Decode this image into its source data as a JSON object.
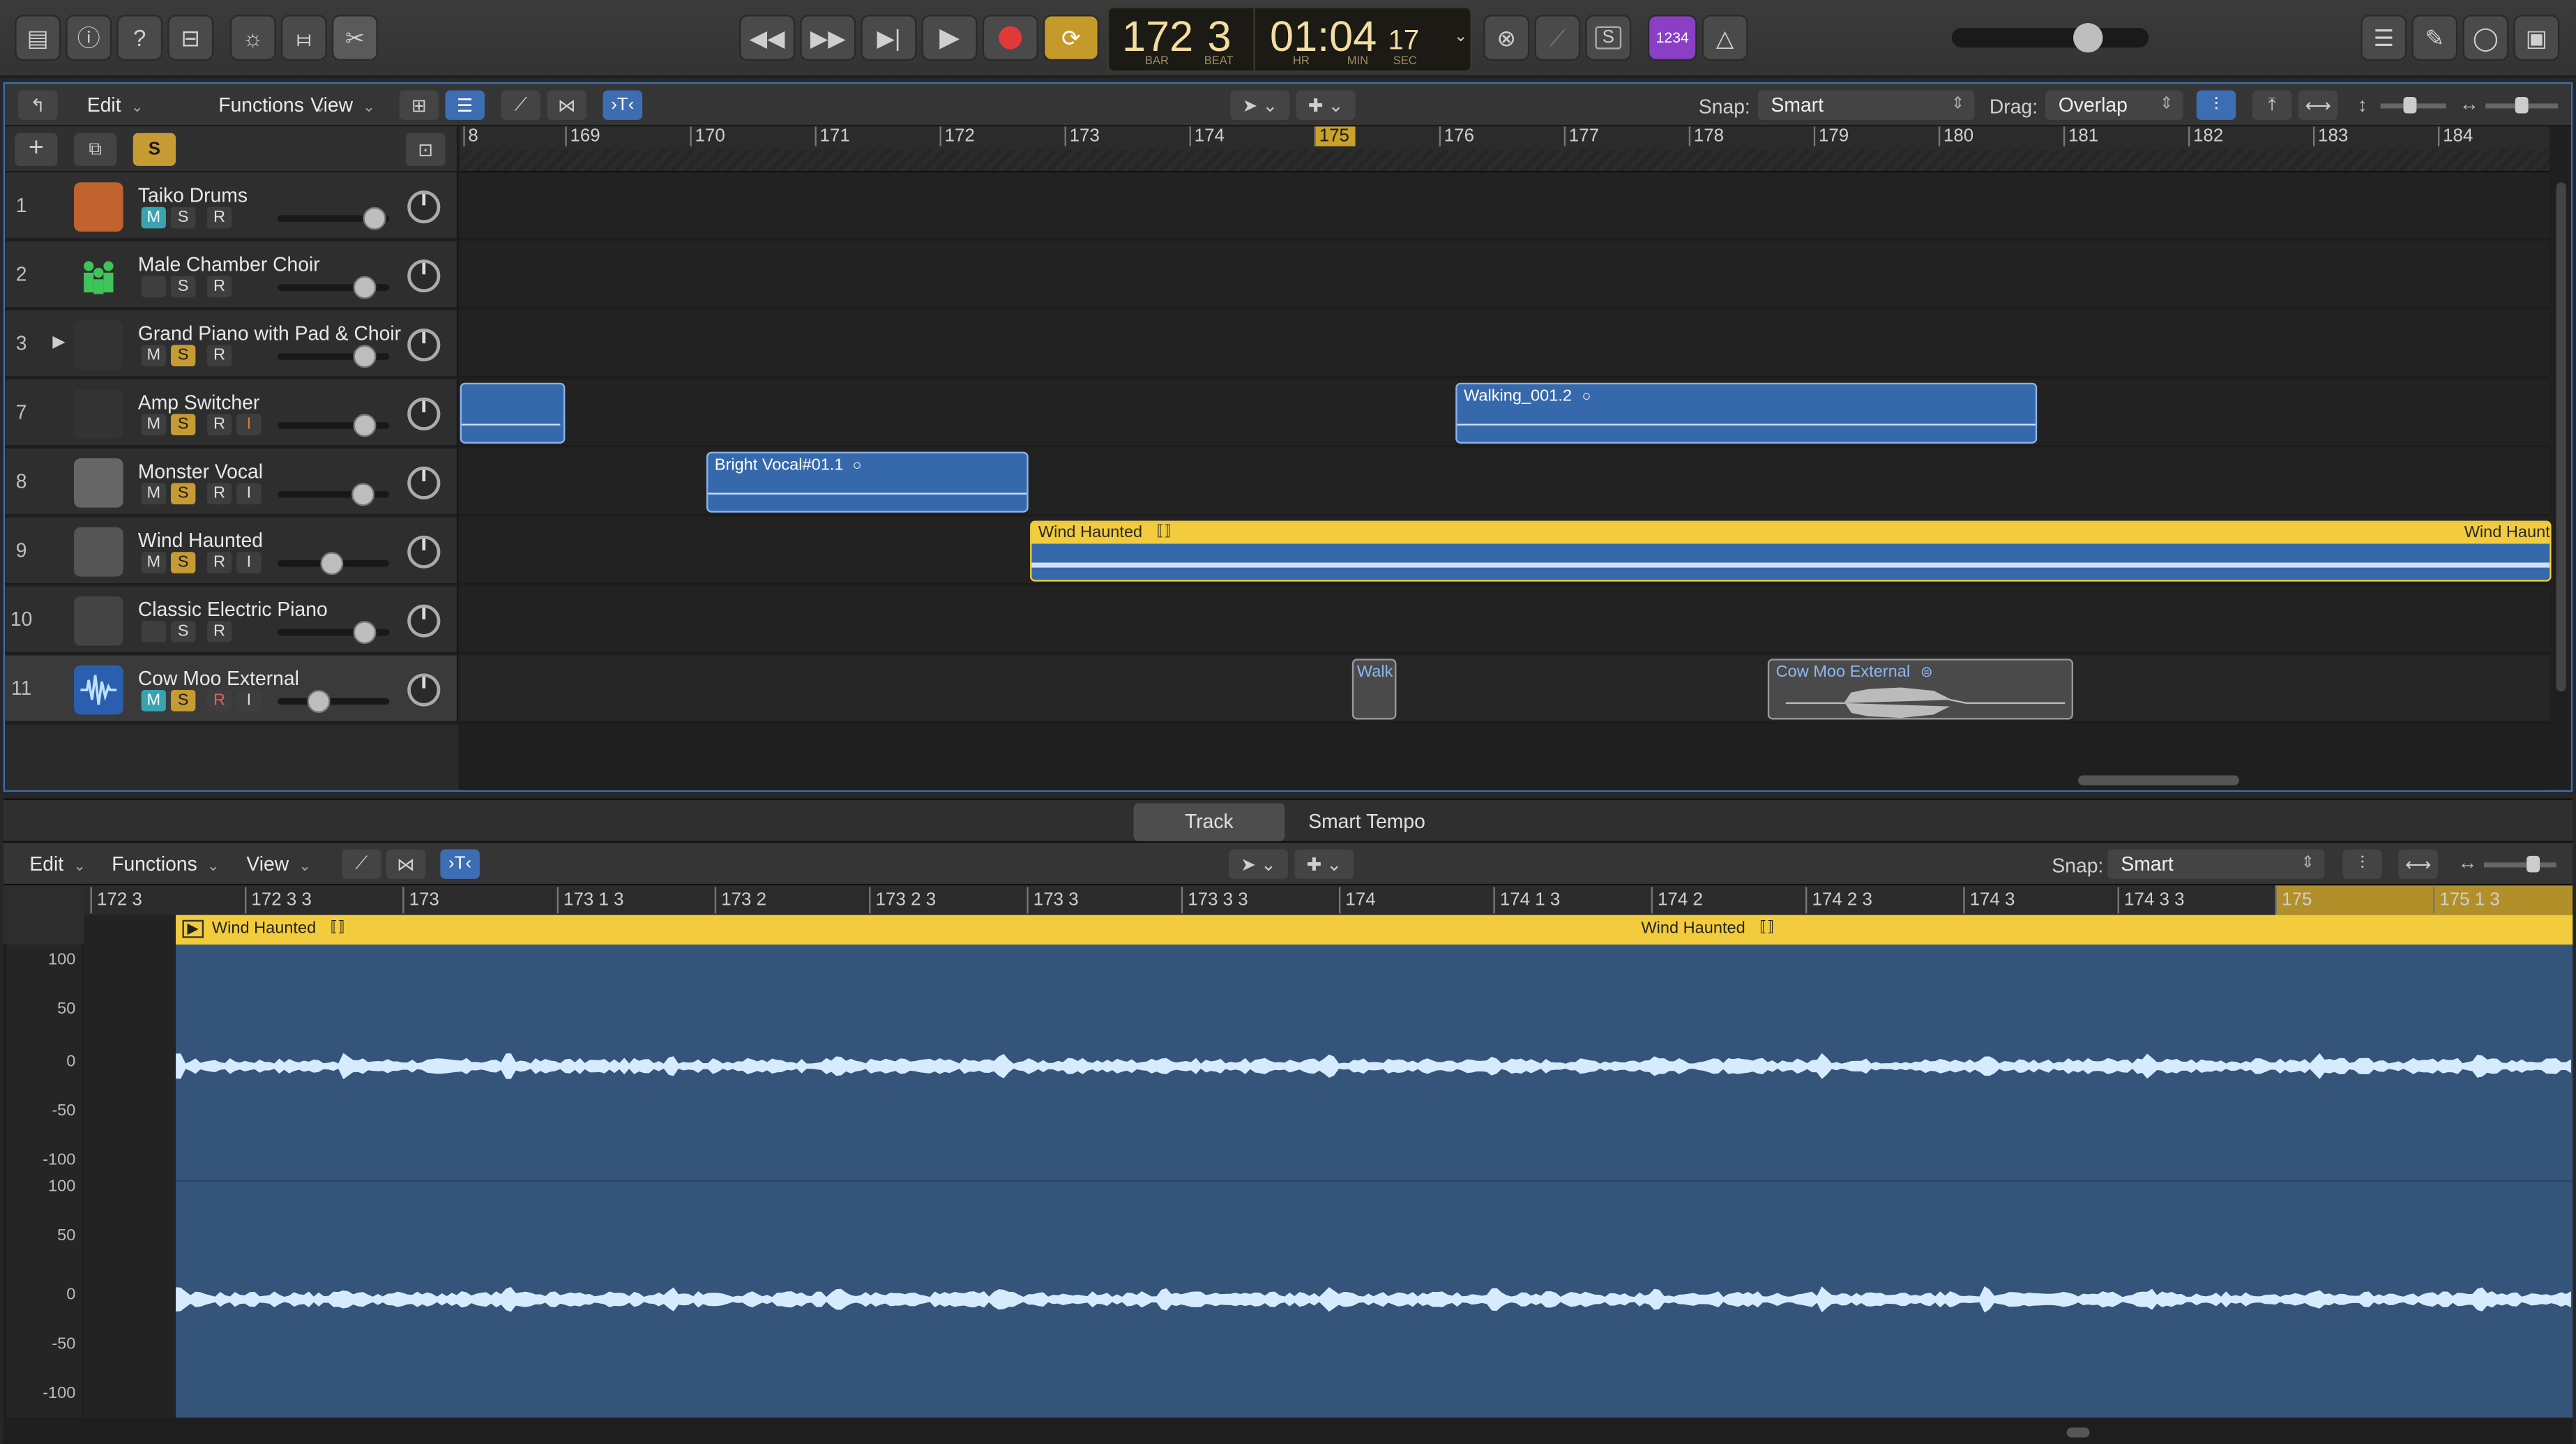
{
  "control_bar": {
    "lcd_bar": "172",
    "lcd_beat": "3",
    "lcd_bar_label": "BAR",
    "lcd_beat_label": "BEAT",
    "lcd_time": "01:04",
    "lcd_sec": "17",
    "lcd_hr_label": "HR",
    "lcd_min_label": "MIN",
    "lcd_sec_label": "SEC",
    "count_in": "1234",
    "s_label": "S"
  },
  "main_menu": {
    "edit": "Edit",
    "functions": "Functions",
    "view": "View",
    "snap_label": "Snap:",
    "snap_value": "Smart",
    "drag_label": "Drag:",
    "drag_value": "Overlap"
  },
  "ruler": [
    {
      "label": "8",
      "highlight": false
    },
    {
      "label": "169",
      "highlight": false
    },
    {
      "label": "170",
      "highlight": false
    },
    {
      "label": "171",
      "highlight": false
    },
    {
      "label": "172",
      "highlight": false
    },
    {
      "label": "173",
      "highlight": false
    },
    {
      "label": "174",
      "highlight": false
    },
    {
      "label": "175",
      "highlight": true
    },
    {
      "label": "176",
      "highlight": false
    },
    {
      "label": "177",
      "highlight": false
    },
    {
      "label": "178",
      "highlight": false
    },
    {
      "label": "179",
      "highlight": false
    },
    {
      "label": "180",
      "highlight": false
    },
    {
      "label": "181",
      "highlight": false
    },
    {
      "label": "182",
      "highlight": false
    },
    {
      "label": "183",
      "highlight": false
    },
    {
      "label": "184",
      "highlight": false
    }
  ],
  "tracks": [
    {
      "num": "1",
      "name": "Taiko Drums",
      "m": "M",
      "s": "S",
      "r": "R",
      "i": "",
      "m_on": true,
      "s_on": false,
      "r_on": false,
      "i_on": false,
      "icon": "drum-icon"
    },
    {
      "num": "2",
      "name": "Male Chamber Choir",
      "m": "",
      "s": "S",
      "r": "R",
      "i": "",
      "m_on": false,
      "s_on": false,
      "r_on": false,
      "i_on": false,
      "icon": "choir-icon"
    },
    {
      "num": "3",
      "name": "Grand Piano with Pad & Choir",
      "m": "M",
      "s": "S",
      "r": "R",
      "i": "",
      "m_on": false,
      "s_on": true,
      "r_on": false,
      "i_on": false,
      "icon": "piano-icon"
    },
    {
      "num": "7",
      "name": "Amp Switcher",
      "m": "M",
      "s": "S",
      "r": "R",
      "i": "I",
      "m_on": false,
      "s_on": true,
      "r_on": false,
      "i_on": true,
      "icon": "amp-icon"
    },
    {
      "num": "8",
      "name": "Monster Vocal",
      "m": "M",
      "s": "S",
      "r": "R",
      "i": "I",
      "m_on": false,
      "s_on": true,
      "r_on": false,
      "i_on": false,
      "icon": "microphone-icon"
    },
    {
      "num": "9",
      "name": "Wind Haunted",
      "m": "M",
      "s": "S",
      "r": "R",
      "i": "I",
      "m_on": false,
      "s_on": true,
      "r_on": false,
      "i_on": false,
      "icon": "guitar-icon"
    },
    {
      "num": "10",
      "name": "Classic Electric Piano",
      "m": "",
      "s": "S",
      "r": "R",
      "i": "",
      "m_on": false,
      "s_on": false,
      "r_on": false,
      "i_on": false,
      "icon": "electric-piano-icon"
    },
    {
      "num": "11",
      "name": "Cow Moo External",
      "m": "M",
      "s": "S",
      "r": "R",
      "i": "I",
      "m_on": true,
      "s_on": true,
      "r_on": true,
      "i_on": false,
      "icon": "waveform-icon"
    }
  ],
  "regions": {
    "walking": "Walking_001.2",
    "bright_vocal": "Bright Vocal#01.1",
    "wind_haunted": "Wind Haunted",
    "wind_haunted_end": "Wind Haunte",
    "walk_small": "Walk",
    "cow_moo": "Cow Moo External"
  },
  "lower_editor": {
    "tab_track": "Track",
    "tab_smart_tempo": "Smart Tempo",
    "edit": "Edit",
    "functions": "Functions",
    "view": "View",
    "snap_label": "Snap:",
    "snap_value": "Smart",
    "ruler": [
      {
        "label": "172 3",
        "highlight": false
      },
      {
        "label": "172 3 3",
        "highlight": false
      },
      {
        "label": "173",
        "highlight": false
      },
      {
        "label": "173 1 3",
        "highlight": false
      },
      {
        "label": "173 2",
        "highlight": false
      },
      {
        "label": "173 2 3",
        "highlight": false
      },
      {
        "label": "173 3",
        "highlight": false
      },
      {
        "label": "173 3 3",
        "highlight": false
      },
      {
        "label": "174",
        "highlight": false
      },
      {
        "label": "174 1 3",
        "highlight": false
      },
      {
        "label": "174 2",
        "highlight": false
      },
      {
        "label": "174 2 3",
        "highlight": false
      },
      {
        "label": "174 3",
        "highlight": false
      },
      {
        "label": "174 3 3",
        "highlight": false
      },
      {
        "label": "175",
        "highlight": true
      },
      {
        "label": "175 1 3",
        "highlight": true
      }
    ],
    "region_name": "Wind Haunted",
    "region_name_2": "Wind Haunted",
    "y_labels_top": [
      "100",
      "50",
      "0",
      "-50",
      "-100"
    ],
    "y_labels_bottom": [
      "100",
      "50",
      "0",
      "-50",
      "-100"
    ]
  }
}
